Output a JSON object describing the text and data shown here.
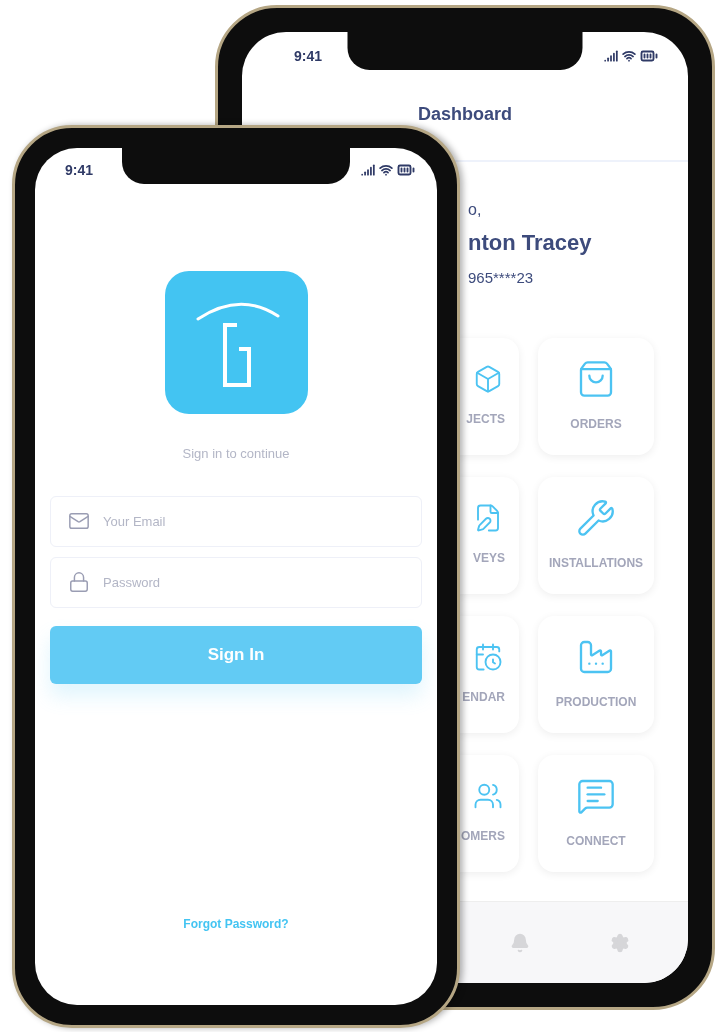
{
  "back_phone": {
    "time": "9:41",
    "title": "Dashboard",
    "greeting": "o,",
    "user_name": "nton Tracey",
    "phone": "965****23",
    "tiles": [
      {
        "label": "JECTS",
        "kind": "clipped"
      },
      {
        "label": "ORDERS",
        "kind": "full"
      },
      {
        "label": "VEYS",
        "kind": "clipped"
      },
      {
        "label": "INSTALLATIONS",
        "kind": "full"
      },
      {
        "label": "ENDAR",
        "kind": "clipped"
      },
      {
        "label": "PRODUCTION",
        "kind": "full"
      },
      {
        "label": "OMERS",
        "kind": "clipped"
      },
      {
        "label": "CONNECT",
        "kind": "full"
      }
    ]
  },
  "front_phone": {
    "time": "9:41",
    "subtitle": "Sign in to continue",
    "fields": [
      {
        "placeholder": "Your Email",
        "kind": "email"
      },
      {
        "placeholder": "Password",
        "kind": "password"
      }
    ],
    "button": "Sign In",
    "link": "Forgot Password?"
  }
}
